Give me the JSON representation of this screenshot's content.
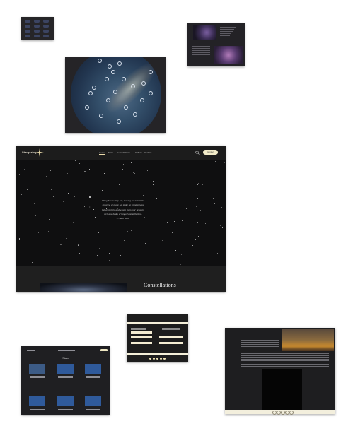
{
  "main_site": {
    "logo_text": "Stargazing",
    "nav": [
      "Home",
      "Stars",
      "Constellations",
      "Gallery",
      "Contact"
    ],
    "contact_button": "Contact",
    "quote_lines": [
      "Things we as they are, looking out into it the",
      "universe at night, we make no comparisons",
      "between right and wrong stars, nor between",
      "well and badly arranged constellations."
    ],
    "quote_author": "— Alan Watts",
    "section_title": "Constellations"
  },
  "stars_page": {
    "heading": "Stars"
  },
  "colors": {
    "accent": "#f3ecc9",
    "dark_background": "#141414",
    "card_blue": "#2f5a9b"
  }
}
